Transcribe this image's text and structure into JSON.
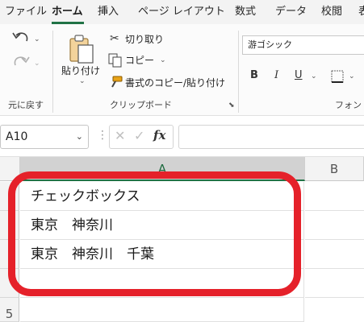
{
  "ribbon_tabs": [
    "ファイル",
    "ホーム",
    "挿入",
    "ページ レイアウト",
    "数式",
    "データ",
    "校閲",
    "表"
  ],
  "active_tab": "ホーム",
  "undo_group": {
    "label": "元に戻す"
  },
  "clipboard": {
    "paste_label": "貼り付け",
    "cut_label": "切り取り",
    "copy_label": "コピー",
    "format_painter_label": "書式のコピー/貼り付け",
    "group_label": "クリップボード"
  },
  "font": {
    "name": "游ゴシック",
    "group_label": "フォント",
    "bold": "B",
    "italic": "I",
    "underline": "U"
  },
  "formula_bar": {
    "name_box": "A10",
    "fx": "fx",
    "value": ""
  },
  "grid": {
    "columns": [
      "A",
      "B"
    ],
    "rows": [
      {
        "text": "チェックボックス"
      },
      {
        "text": "東京　神奈川"
      },
      {
        "text": "東京　神奈川　千葉"
      },
      {
        "text": ""
      }
    ],
    "visible_row_number": "5"
  },
  "colors": {
    "accent": "#217346",
    "highlight": "#e5212a"
  }
}
